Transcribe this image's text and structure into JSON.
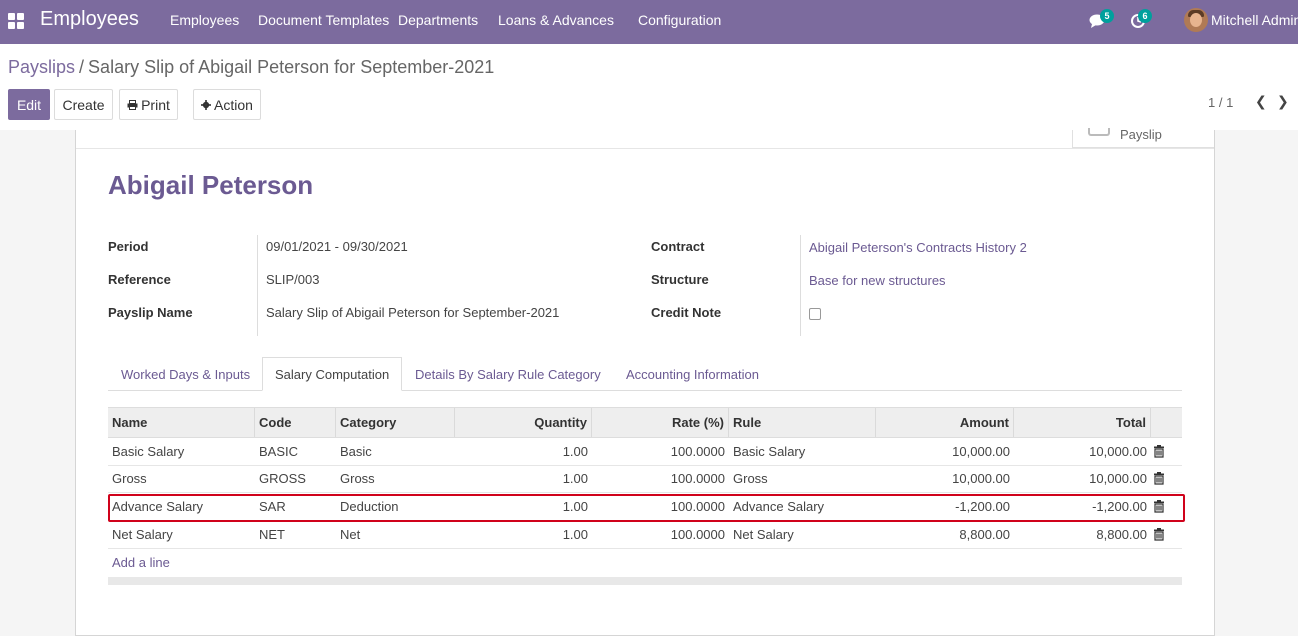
{
  "navbar": {
    "brand": "Employees",
    "menu": [
      "Employees",
      "Document Templates",
      "Departments",
      "Loans & Advances",
      "Configuration"
    ],
    "chat_count": "5",
    "activity_count": "6",
    "user_name": "Mitchell Admin"
  },
  "breadcrumb": {
    "parent": "Payslips",
    "separator": "/",
    "current": "Salary Slip of Abigail Peterson for September-2021"
  },
  "toolbar": {
    "edit_label": "Edit",
    "create_label": "Create",
    "print_label": "Print",
    "action_label": "Action"
  },
  "pager": {
    "value": "1 / 1"
  },
  "button_box": {
    "label": "Payslip"
  },
  "form": {
    "employee_name": "Abigail Peterson",
    "left_fields": [
      {
        "label": "Period",
        "value": "09/01/2021 - 09/30/2021"
      },
      {
        "label": "Reference",
        "value": "SLIP/003"
      },
      {
        "label": "Payslip Name",
        "value": "Salary Slip of Abigail Peterson for September-2021"
      }
    ],
    "right_fields": [
      {
        "label": "Contract",
        "value": "Abigail Peterson's Contracts History 2"
      },
      {
        "label": "Structure",
        "value": "Base for new structures"
      },
      {
        "label": "Credit Note",
        "value": ""
      }
    ],
    "credit_note_checked": false
  },
  "tabs": [
    "Worked Days & Inputs",
    "Salary Computation",
    "Details By Salary Rule Category",
    "Accounting Information"
  ],
  "active_tab": "Salary Computation",
  "table": {
    "headers": [
      "Name",
      "Code",
      "Category",
      "Quantity",
      "Rate (%)",
      "Rule",
      "Amount",
      "Total"
    ],
    "rows": [
      [
        "Basic Salary",
        "BASIC",
        "Basic",
        "1.00",
        "100.0000",
        "Basic Salary",
        "10,000.00",
        "10,000.00"
      ],
      [
        "Gross",
        "GROSS",
        "Gross",
        "1.00",
        "100.0000",
        "Gross",
        "10,000.00",
        "10,000.00"
      ],
      [
        "Advance Salary",
        "SAR",
        "Deduction",
        "1.00",
        "100.0000",
        "Advance Salary",
        "-1,200.00",
        "-1,200.00"
      ],
      [
        "Net Salary",
        "NET",
        "Net",
        "1.00",
        "100.0000",
        "Net Salary",
        "8,800.00",
        "8,800.00"
      ]
    ],
    "add_line_label": "Add a line",
    "highlight_color": "#d0021b"
  },
  "colors": {
    "navbar": "#7c6b9e",
    "accent_link": "#6b5a92",
    "badge": "#00a09d"
  }
}
